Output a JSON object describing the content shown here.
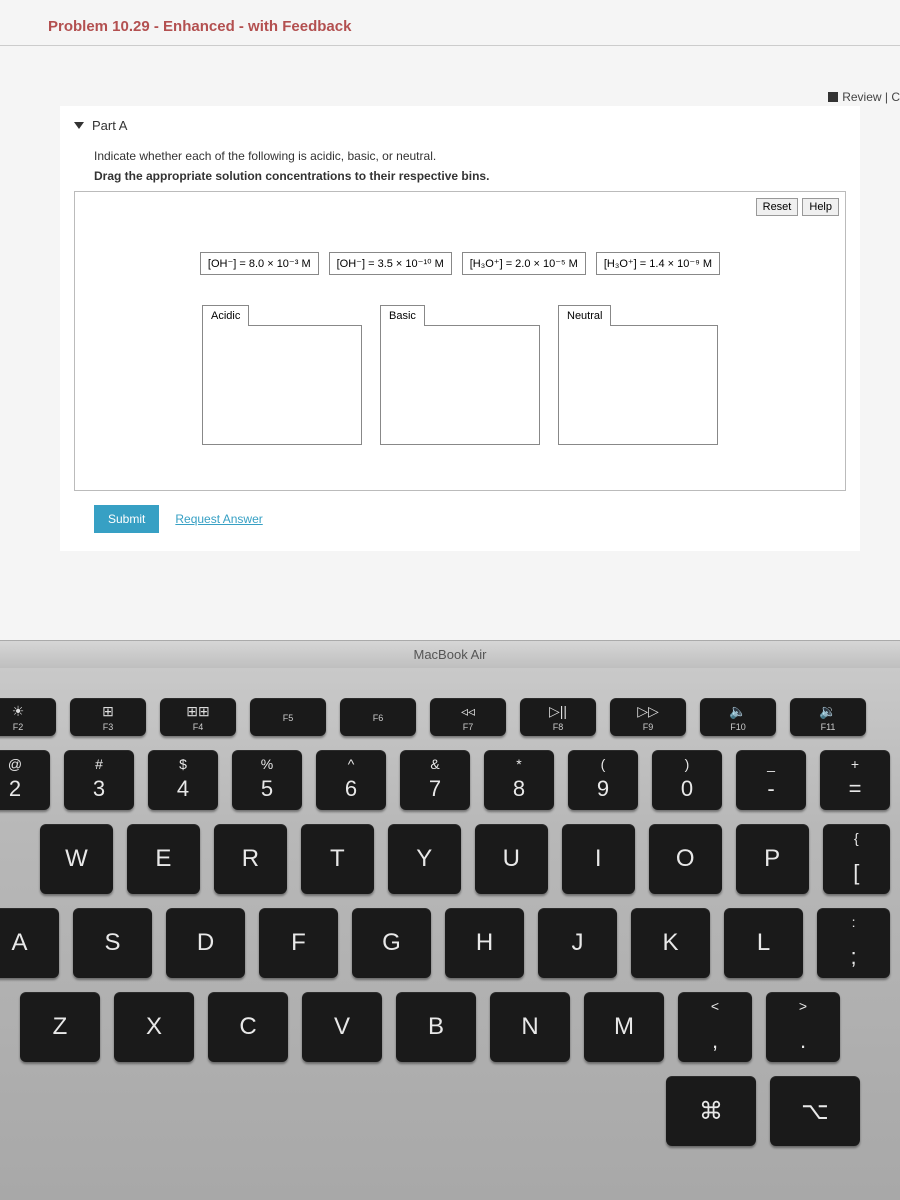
{
  "title": "Problem 10.29 - Enhanced - with Feedback",
  "review_label": "Review | C",
  "part": {
    "label": "Part A",
    "instruction1": "Indicate whether each of the following is acidic, basic, or neutral.",
    "instruction2": "Drag the appropriate solution concentrations to their respective bins.",
    "reset": "Reset",
    "help": "Help",
    "draggables": [
      "[OH⁻] = 8.0 × 10⁻³ M",
      "[OH⁻] = 3.5 × 10⁻¹⁰ M",
      "[H₃O⁺] = 2.0 × 10⁻⁵ M",
      "[H₃O⁺] = 1.4 × 10⁻⁹ M"
    ],
    "bins": [
      "Acidic",
      "Basic",
      "Neutral"
    ],
    "submit": "Submit",
    "request": "Request Answer"
  },
  "hinge": "MacBook Air",
  "keyboard": {
    "frow": [
      {
        "icon": "☀",
        "label": "F2"
      },
      {
        "icon": "⊞",
        "label": "F3"
      },
      {
        "icon": "⊞⊞",
        "label": "F4"
      },
      {
        "icon": "",
        "label": "F5"
      },
      {
        "icon": "",
        "label": "F6"
      },
      {
        "icon": "◃◃",
        "label": "F7"
      },
      {
        "icon": "▷||",
        "label": "F8"
      },
      {
        "icon": "▷▷",
        "label": "F9"
      },
      {
        "icon": "🔈",
        "label": "F10"
      },
      {
        "icon": "🔉",
        "label": "F11"
      }
    ],
    "numrow": [
      {
        "u": "@",
        "l": "2"
      },
      {
        "u": "#",
        "l": "3"
      },
      {
        "u": "$",
        "l": "4"
      },
      {
        "u": "%",
        "l": "5"
      },
      {
        "u": "^",
        "l": "6"
      },
      {
        "u": "&",
        "l": "7"
      },
      {
        "u": "*",
        "l": "8"
      },
      {
        "u": "(",
        "l": "9"
      },
      {
        "u": ")",
        "l": "0"
      },
      {
        "u": "_",
        "l": "-"
      },
      {
        "u": "+",
        "l": "="
      }
    ],
    "row_qwerty": [
      "W",
      "E",
      "R",
      "T",
      "Y",
      "U",
      "I",
      "O",
      "P"
    ],
    "row_qwerty_end": {
      "u": "{",
      "l": "["
    },
    "row_asdf_pre": "A",
    "row_asdf": [
      "S",
      "D",
      "F",
      "G",
      "H",
      "J",
      "K",
      "L"
    ],
    "row_asdf_end": {
      "u": ":",
      "l": ";"
    },
    "row_zxcv": [
      "Z",
      "X",
      "C",
      "V",
      "B",
      "N",
      "M"
    ],
    "row_zxcv_end1": {
      "u": "<",
      "l": ","
    },
    "row_zxcv_end2": {
      "u": ">",
      "l": "."
    }
  }
}
